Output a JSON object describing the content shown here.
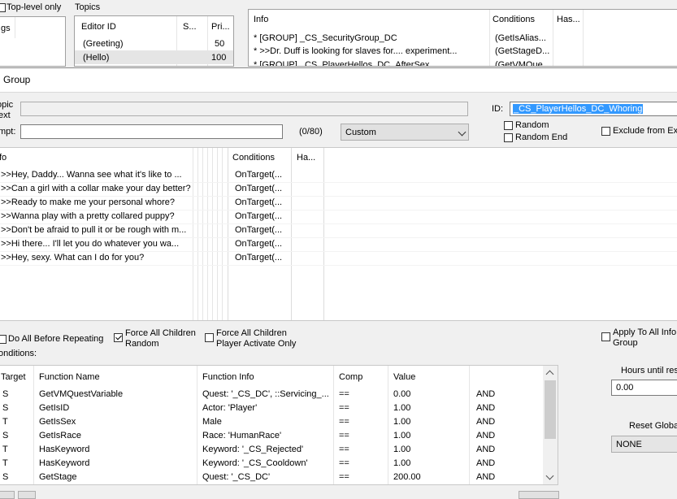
{
  "top": {
    "toplevel_label": "Top-level only",
    "topics_label": "Topics",
    "left_partial_text": "gs",
    "topics_headers": [
      "Editor ID",
      "S...",
      "Pri..."
    ],
    "topics_rows": [
      {
        "id": "(Greeting)",
        "s": "",
        "pri": "50"
      },
      {
        "id": "(Hello)",
        "s": "",
        "pri": "100"
      }
    ],
    "info_headers": [
      "Info",
      "Conditions",
      "Has..."
    ],
    "info_rows": [
      {
        "info": "* [GROUP] _CS_SecurityGroup_DC",
        "cond": "(GetIsAlias..."
      },
      {
        "info": "* >>Dr. Duff is looking for slaves for.... experiment...",
        "cond": "(GetStageD..."
      },
      {
        "info": "* [GROUP] _CS_PlayerHellos_DC_AfterSex",
        "cond": "(GetVMQue..."
      }
    ]
  },
  "group": {
    "title": "Group",
    "topic_text_label_1": "opic",
    "topic_text_label_2": "ext",
    "id_label": "ID:",
    "id_value": "_CS_PlayerHellos_DC_Whoring",
    "prompt_label": "mpt:",
    "prompt_value": "",
    "char_count": "(0/80)",
    "combo_value": "Custom",
    "random_label": "Random",
    "random_end_label": "Random End",
    "exclude_label": "Exclude from Exp"
  },
  "responses": {
    "headers": [
      "fo",
      "Conditions",
      "Ha..."
    ],
    "rows": [
      {
        "text": ">>Hey, Daddy... Wanna see what it's like to ...",
        "cond": "OnTarget(..."
      },
      {
        "text": ">>Can a girl with a collar make your day better?",
        "cond": "OnTarget(..."
      },
      {
        "text": ">>Ready to make me your personal whore?",
        "cond": "OnTarget(..."
      },
      {
        "text": ">>Wanna play with a pretty collared puppy?",
        "cond": "OnTarget(..."
      },
      {
        "text": ">>Don't be afraid to pull it or be rough with m...",
        "cond": "OnTarget(..."
      },
      {
        "text": ">>Hi there... I'll let you do whatever you wa...",
        "cond": "OnTarget(..."
      },
      {
        "text": ">>Hey, sexy. What can I do for you?",
        "cond": "OnTarget(..."
      }
    ]
  },
  "options": {
    "do_all_label": "Do All Before Repeating",
    "force_random_1": "Force All Children",
    "force_random_2": "Random",
    "force_player_1": "Force All Children",
    "force_player_2": "Player Activate Only",
    "apply_info_1": "Apply To All Info",
    "apply_info_2": "Group",
    "conditions_label": "onditions:",
    "hours_label": "Hours until res",
    "hours_value": "0.00",
    "reset_label": "Reset Global",
    "reset_value": "NONE"
  },
  "conditions": {
    "headers": [
      "Target",
      "Function Name",
      "Function Info",
      "Comp",
      "Value",
      ""
    ],
    "rows": [
      {
        "target": "S",
        "fn": "GetVMQuestVariable",
        "info": "Quest: '_CS_DC', ::Servicing_...",
        "comp": "==",
        "value": "0.00",
        "and": "AND"
      },
      {
        "target": "S",
        "fn": "GetIsID",
        "info": "Actor: 'Player'",
        "comp": "==",
        "value": "1.00",
        "and": "AND"
      },
      {
        "target": "T",
        "fn": "GetIsSex",
        "info": "Male",
        "comp": "==",
        "value": "1.00",
        "and": "AND"
      },
      {
        "target": "S",
        "fn": "GetIsRace",
        "info": "Race: 'HumanRace'",
        "comp": "==",
        "value": "1.00",
        "and": "AND"
      },
      {
        "target": "T",
        "fn": "HasKeyword",
        "info": "Keyword: '_CS_Rejected'",
        "comp": "==",
        "value": "1.00",
        "and": "AND"
      },
      {
        "target": "T",
        "fn": "HasKeyword",
        "info": "Keyword: '_CS_Cooldown'",
        "comp": "==",
        "value": "1.00",
        "and": "AND"
      },
      {
        "target": "S",
        "fn": "GetStage",
        "info": "Quest: '_CS_DC'",
        "comp": "==",
        "value": "200.00",
        "and": "AND"
      }
    ]
  },
  "colors": {
    "selection": "#3399ff",
    "row_highlight": "#e5f3ff"
  }
}
